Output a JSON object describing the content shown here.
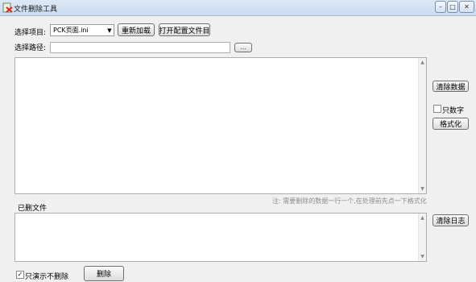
{
  "window": {
    "title": "文件删除工具",
    "min_glyph": "–",
    "max_glyph": "□",
    "close_glyph": "✕"
  },
  "top": {
    "project_label": "选择项目:",
    "project_selected": "PCK页面.ini",
    "reload_label": "重新加载",
    "open_config_label": "打开配置文件目",
    "path_label": "选择路径:",
    "path_value": "",
    "browse_label": "..."
  },
  "right": {
    "clear_data_label": "清除数据",
    "numbers_only_label": "只数字",
    "format_label": "格式化",
    "clear_log_label": "清除日志"
  },
  "hint": "注: 需要删除的数据一行一个,在处理前先点一下格式化",
  "deleted_files_label": "已删文件",
  "bottom": {
    "demo_only_label": "只演示不删除",
    "delete_label": "删除"
  },
  "icons": {
    "app": "app-icon",
    "scroll_up": "▲",
    "scroll_down": "▼",
    "combo_arrow": "▼",
    "check": "✓"
  }
}
